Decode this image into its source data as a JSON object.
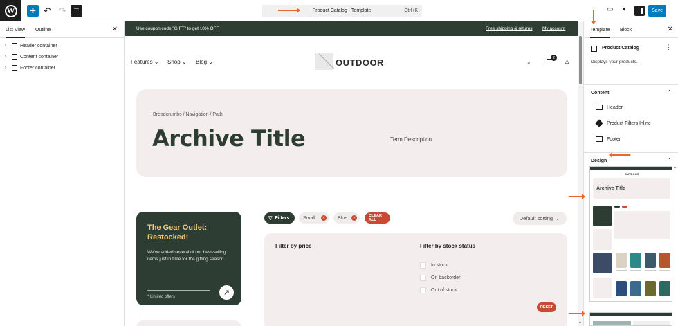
{
  "toolbar": {
    "command_title": "Product Catalog · Template",
    "command_shortcut": "Ctrl+K",
    "save_label": "Save"
  },
  "left_panel": {
    "tab_list_view": "List View",
    "tab_outline": "Outline",
    "items": [
      {
        "label": "Header container"
      },
      {
        "label": "Content container"
      },
      {
        "label": "Footer container"
      }
    ]
  },
  "canvas": {
    "coupon_message": "Use coupon code \"GIFT\" to get 10% OFF.",
    "coupon_link_shipping": "Free shipping & returns",
    "coupon_link_account": "My account",
    "nav": {
      "features": "Features",
      "shop": "Shop",
      "blog": "Blog",
      "logo": "OUTDOOR",
      "cart_count": "2"
    },
    "hero": {
      "breadcrumbs": "Breadcrumbs / Navigation / Path",
      "title": "Archive Title",
      "description": "Term Description"
    },
    "promo": {
      "title": "The Gear Outlet: Restocked!",
      "text": "We've added several of our best-selling items just in time for the gifting season.",
      "note": "* Limited offers"
    },
    "chips": {
      "filters": "Filters",
      "small": "Small",
      "blue": "Blue",
      "clear_all": "CLEAR ALL"
    },
    "sorting": "Default sorting",
    "filters": {
      "price_heading": "Filter by price",
      "stock_heading": "Filter by stock status",
      "options": [
        "In stock",
        "On backorder",
        "Out of stock"
      ],
      "reset": "RESET"
    }
  },
  "right_panel": {
    "tab_template": "Template",
    "tab_block": "Block",
    "template_name": "Product Catalog",
    "template_desc": "Displays your products.",
    "content_heading": "Content",
    "parts": [
      {
        "label": "Header"
      },
      {
        "label": "Product Filters Inline"
      },
      {
        "label": "Footer"
      }
    ],
    "design_heading": "Design",
    "preview_title": "Archive Title",
    "preview_logo": "OUTDOOR"
  },
  "colors": {
    "accent": "#007cba",
    "brand_green": "#2e3d33",
    "brand_cream": "#f3eeed",
    "brand_red": "#c94a34",
    "annotation_orange": "#e8672c"
  }
}
